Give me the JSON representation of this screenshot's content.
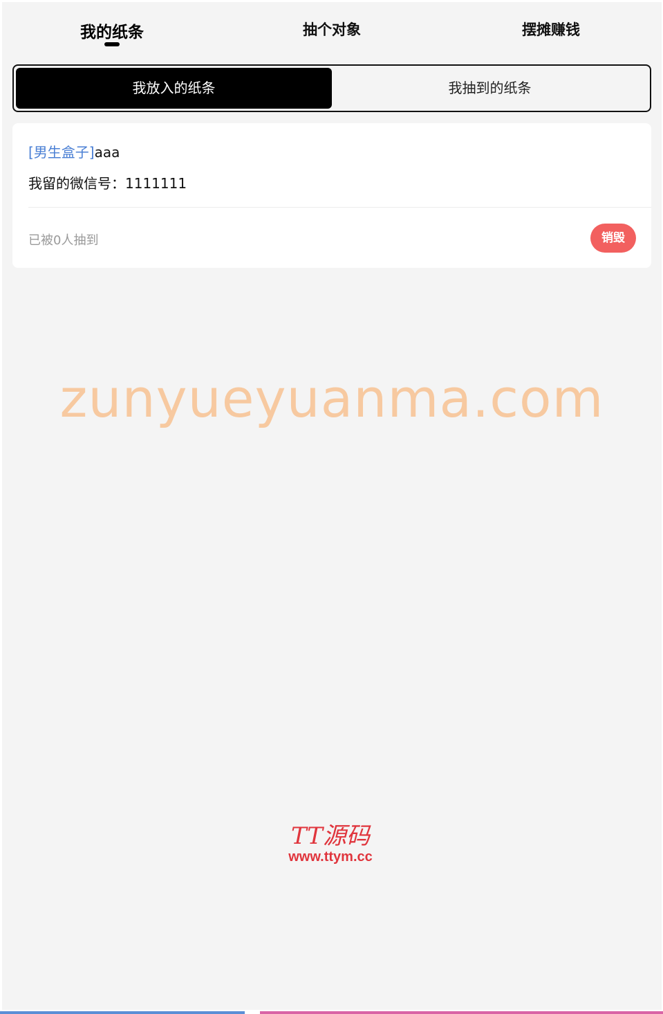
{
  "nav": {
    "tabs": [
      {
        "label": "我的纸条",
        "active": true
      },
      {
        "label": "抽个对象",
        "active": false
      },
      {
        "label": "摆摊赚钱",
        "active": false
      }
    ]
  },
  "segment": {
    "put_label": "我放入的纸条",
    "drawn_label": "我抽到的纸条",
    "active": "put"
  },
  "note": {
    "box_tag": "[男生盒子]",
    "content": "aaa",
    "wechat_text": "我留的微信号：1111111",
    "drawn_count_text": "已被0人抽到",
    "destroy_label": "销毁"
  },
  "watermark": {
    "main_text": "zunyueyuanma.com",
    "logo_brand": "TT源码",
    "logo_url": "www.ttym.cc"
  },
  "colors": {
    "accent_active": "#000000",
    "tag_blue": "#4a7fd4",
    "destroy_red": "#f2605f",
    "watermark_orange": "#f7c9a0",
    "logo_red": "#e0353d"
  }
}
